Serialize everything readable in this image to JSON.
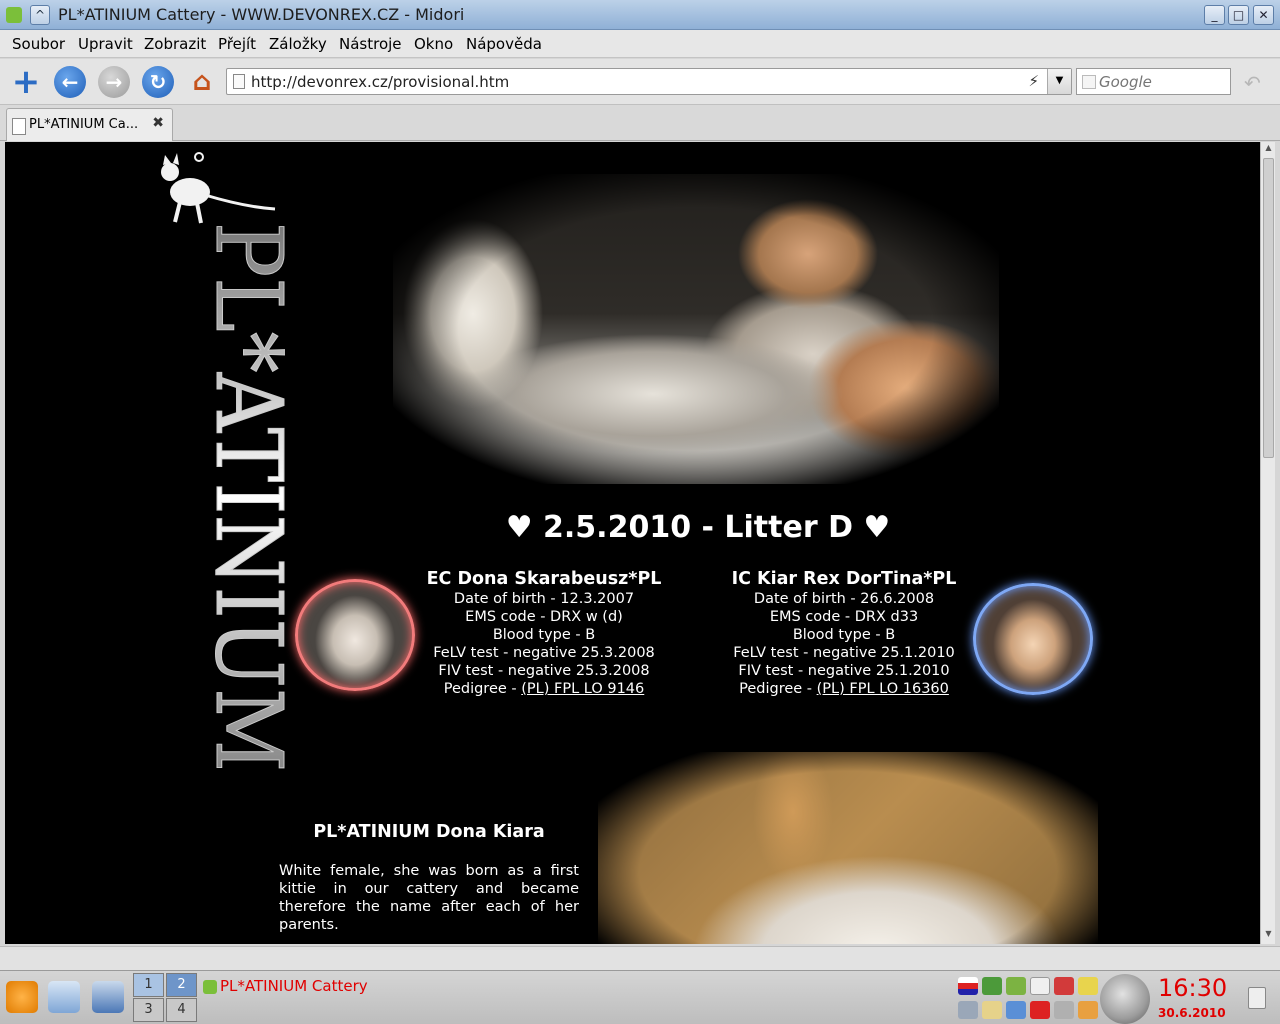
{
  "window": {
    "title": "PL*ATINIUM Cattery - WWW.DEVONREX.CZ - Midori",
    "shade_glyph": "^",
    "minimize_glyph": "_",
    "maximize_glyph": "□",
    "close_glyph": "✕"
  },
  "menu": [
    "Soubor",
    "Upravit",
    "Zobrazit",
    "Přejít",
    "Záložky",
    "Nástroje",
    "Okno",
    "Nápověda"
  ],
  "toolbar": {
    "new_tab_glyph": "+",
    "back_glyph": "←",
    "forward_glyph": "→",
    "reload_glyph": "↻",
    "home_glyph": "⌂",
    "url": "http://devonrex.cz/provisional.htm",
    "feed_glyph": "⚡",
    "dropdown_glyph": "▼",
    "search_placeholder": "Google",
    "undo_glyph": "↶"
  },
  "tab": {
    "label": "PL*ATINIUM Ca...",
    "close_glyph": "✖"
  },
  "page": {
    "logo_text": "PL*ATINIUM",
    "litter_title": "♥ 2.5.2010 - Litter D ♥",
    "mother": {
      "name": "EC Dona Skarabeusz*PL",
      "dob": "Date of birth - 12.3.2007",
      "ems": "EMS code - DRX w (d)",
      "blood": "Blood type - B",
      "felv": "FeLV test - negative 25.3.2008",
      "fiv": "FIV test - negative 25.3.2008",
      "pedigree_prefix": "Pedigree - ",
      "pedigree_link": "(PL) FPL LO 9146"
    },
    "father": {
      "name": "IC Kiar Rex DorTina*PL",
      "dob": "Date of birth - 26.6.2008",
      "ems": "EMS code - DRX d33",
      "blood": "Blood type - B",
      "felv": "FeLV test - negative 25.1.2010",
      "fiv": "FIV test - negative 25.1.2010",
      "pedigree_prefix": "Pedigree - ",
      "pedigree_link": "(PL) FPL LO 16360"
    },
    "kitten": {
      "title": "PL*ATINIUM Dona Kiara",
      "text": "White female, she was born as a first kittie in our cattery and became therefore the name after each of her parents."
    }
  },
  "taskbar": {
    "pager": [
      "1",
      "2",
      "3",
      "4"
    ],
    "task_label": "PL*ATINIUM Cattery",
    "time": "16:30",
    "date": "30.6.2010",
    "accent_color": "#e00000"
  }
}
